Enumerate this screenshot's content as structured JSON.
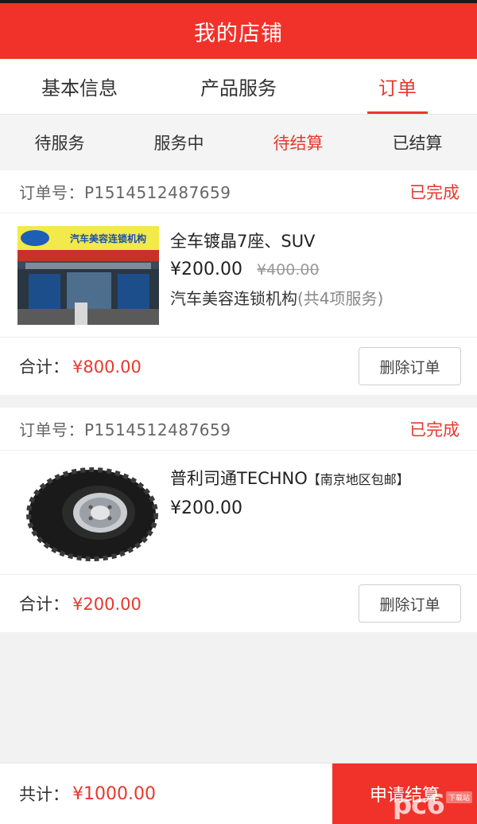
{
  "header": {
    "title": "我的店铺"
  },
  "main_tabs": [
    {
      "label": "基本信息",
      "active": false
    },
    {
      "label": "产品服务",
      "active": false
    },
    {
      "label": "订单",
      "active": true
    }
  ],
  "sub_tabs": [
    {
      "label": "待服务",
      "active": false
    },
    {
      "label": "服务中",
      "active": false
    },
    {
      "label": "待结算",
      "active": true
    },
    {
      "label": "已结算",
      "active": false
    }
  ],
  "orders": [
    {
      "order_no": "订单号：P1514512487659",
      "status": "已完成",
      "product_name": "全车镀晶7座、SUV",
      "price": "¥200.00",
      "old_price": "¥400.00",
      "shop": "汽车美容连锁机构",
      "service_count": "(共4项服务)",
      "thumb_sign": "汽车美容连锁机构",
      "total_label": "合计：",
      "total": "¥800.00",
      "delete_label": "删除订单"
    },
    {
      "order_no": "订单号：P1514512487659",
      "status": "已完成",
      "product_name": "普利司通TECHNO",
      "product_tag": "【南京地区包邮】",
      "price": "¥200.00",
      "total_label": "合计：",
      "total": "¥200.00",
      "delete_label": "删除订单"
    }
  ],
  "bottom": {
    "total_label": "共计：",
    "total": "¥1000.00",
    "settle_label": "申请结算"
  },
  "watermark": {
    "logo": "pc6",
    "badge": "下载站"
  },
  "colors": {
    "brand_red": "#f1322a",
    "accent_red": "#e8382f"
  }
}
